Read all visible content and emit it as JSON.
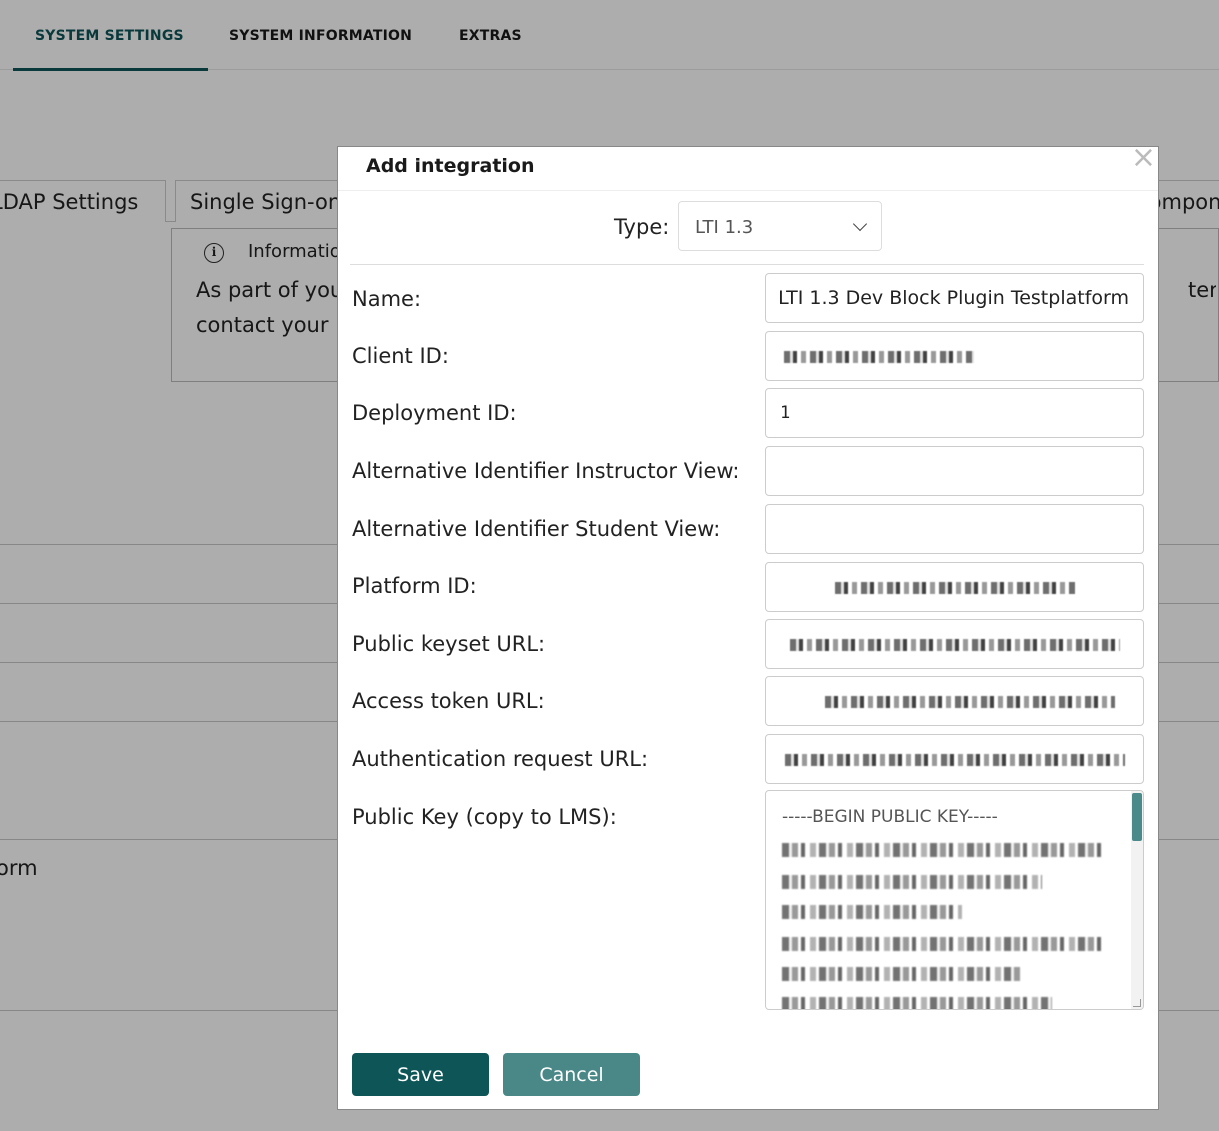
{
  "top_tabs": [
    {
      "label": "SYSTEM SETTINGS",
      "active": true
    },
    {
      "label": "SYSTEM INFORMATION",
      "active": false
    },
    {
      "label": "EXTRAS",
      "active": false
    }
  ],
  "sub_tabs": [
    {
      "label": "LDAP Settings"
    },
    {
      "label": "Single Sign-on"
    },
    {
      "label": "Components"
    }
  ],
  "info_box": {
    "icon": "info-icon",
    "title": "Information",
    "line1_start": "As part of you",
    "line1_end": "terfac",
    "line2": "contact your"
  },
  "background_rows": [
    {
      "label": ""
    },
    {
      "label": ""
    },
    {
      "label": ""
    },
    {
      "label": ""
    },
    {
      "label": ""
    },
    {
      "label": "orm"
    },
    {
      "label": ""
    }
  ],
  "modal": {
    "title": "Add integration",
    "close_icon": "close-icon",
    "type_label": "Type:",
    "type_value": "LTI 1.3",
    "fields": [
      {
        "label": "Name:",
        "value": "LTI 1.3 Dev Block Plugin Testplatform"
      },
      {
        "label": "Client ID:",
        "value": ""
      },
      {
        "label": "Deployment ID:",
        "value": "1"
      },
      {
        "label": "Alternative Identifier Instructor View:",
        "value": ""
      },
      {
        "label": "Alternative Identifier Student View:",
        "value": ""
      },
      {
        "label": "Platform ID:",
        "value": ""
      },
      {
        "label": "Public keyset URL:",
        "value": ""
      },
      {
        "label": "Access token URL:",
        "value": ""
      },
      {
        "label": "Authentication request URL:",
        "value": ""
      }
    ],
    "public_key_label": "Public Key (copy to LMS):",
    "public_key_header": "-----BEGIN PUBLIC KEY-----",
    "save_label": "Save",
    "cancel_label": "Cancel"
  },
  "colors": {
    "primary": "#0e5557",
    "secondary": "#4a8887",
    "scrollbar": "#4b8a8b"
  }
}
